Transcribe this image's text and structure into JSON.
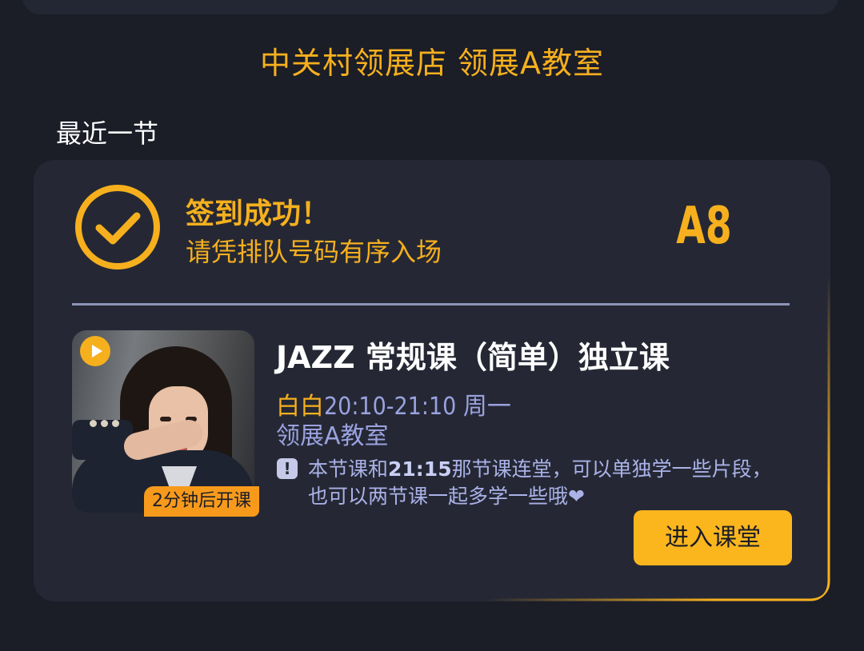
{
  "venue_title": "中关村领展店 领展A教室",
  "section_label": "最近一节",
  "checkin": {
    "title": "签到成功！",
    "subtitle": "请凭排队号码有序入场",
    "queue_number": "A8"
  },
  "course": {
    "title": "JAZZ 常规课（简单）独立课",
    "teacher": "白白",
    "time": "20:10-21:10 周一",
    "room": "领展A教室",
    "notice_prefix": "本节课和",
    "notice_time": "21:15",
    "notice_body": "那节课连堂，可以单独学一些片段，也可以两节课一起多学一些哦❤",
    "start_badge": "2分钟后开课"
  },
  "actions": {
    "enter_label": "进入课堂"
  },
  "icons": {
    "checkin": "check-circle-icon",
    "play": "play-icon",
    "notice": "exclamation-icon"
  },
  "colors": {
    "background": "#1b1d27",
    "card": "#252834",
    "accent": "#f6b01e",
    "muted_blue": "#9aa2df",
    "badge_orange": "#f79a1c"
  }
}
